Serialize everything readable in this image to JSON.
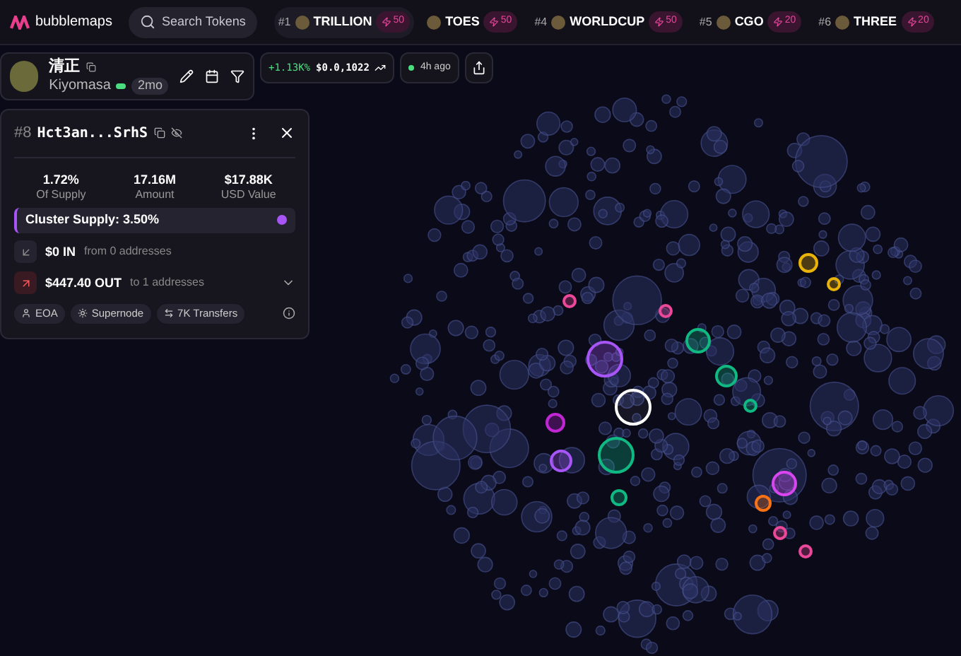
{
  "brand": "bubblemaps",
  "search": {
    "placeholder": "Search Tokens"
  },
  "trending": [
    {
      "rank": "#1",
      "name": "TRILLION",
      "boost": "50",
      "selected": true
    },
    {
      "name": "TOES",
      "boost": "50",
      "selected": false
    },
    {
      "rank": "#4",
      "name": "WORLDCUP",
      "boost": "50",
      "selected": false
    },
    {
      "rank": "#5",
      "name": "CGO",
      "boost": "20",
      "selected": false
    },
    {
      "rank": "#6",
      "name": "THREE",
      "boost": "20",
      "selected": false
    }
  ],
  "token": {
    "name": "清正",
    "symbol": "Kiyomasa",
    "age": "2mo"
  },
  "price": {
    "change": "+1.13K%",
    "value": "$0.0,1022"
  },
  "updated": "4h ago",
  "wallet": {
    "rank": "#8",
    "address": "Hct3an...SrhS",
    "stats": [
      {
        "value": "1.72%",
        "label": "Of Supply"
      },
      {
        "value": "17.16M",
        "label": "Amount"
      },
      {
        "value": "$17.88K",
        "label": "USD Value"
      }
    ],
    "cluster": {
      "label": "Cluster Supply: 3.50%",
      "color": "#a855f7"
    },
    "flows": [
      {
        "kind": "in",
        "amount": "$0 IN",
        "detail": "from 0 addresses"
      },
      {
        "kind": "out",
        "amount": "$447.40 OUT",
        "detail": "to 1 addresses"
      }
    ],
    "tags": [
      {
        "kind": "user",
        "label": "EOA"
      },
      {
        "kind": "sun",
        "label": "Supernode"
      },
      {
        "kind": "transfer",
        "label": "7K Transfers"
      }
    ]
  }
}
